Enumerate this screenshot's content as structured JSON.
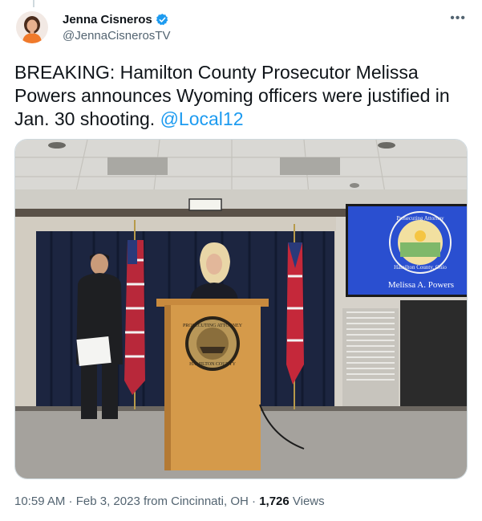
{
  "author": {
    "display_name": "Jenna Cisneros",
    "handle": "@JennaCisnerosTV"
  },
  "icons": {
    "verified": "verified-badge-icon",
    "more": "more-options-icon"
  },
  "tweet": {
    "text": "BREAKING: Hamilton County Prosecutor Melissa Powers announces Wyoming officers were justified in Jan. 30 shooting. ",
    "mention": "@Local12"
  },
  "media": {
    "screen_caption": "Melissa A. Powers",
    "screen_seal_top": "Prosecuting Attorney",
    "screen_seal_bottom": "Hamilton County, Ohio",
    "podium_seal_top": "PROSECUTING ATTORNEY",
    "podium_seal_bottom": "HAMILTON COUNTY"
  },
  "meta": {
    "time": "10:59 AM",
    "separator": " · ",
    "date": "Feb 3, 2023",
    "location": " from Cincinnati, OH",
    "views_count": "1,726",
    "views_label": " Views"
  },
  "colors": {
    "link": "#1d9bf0",
    "secondary_text": "#536471",
    "verified": "#1d9bf0"
  }
}
